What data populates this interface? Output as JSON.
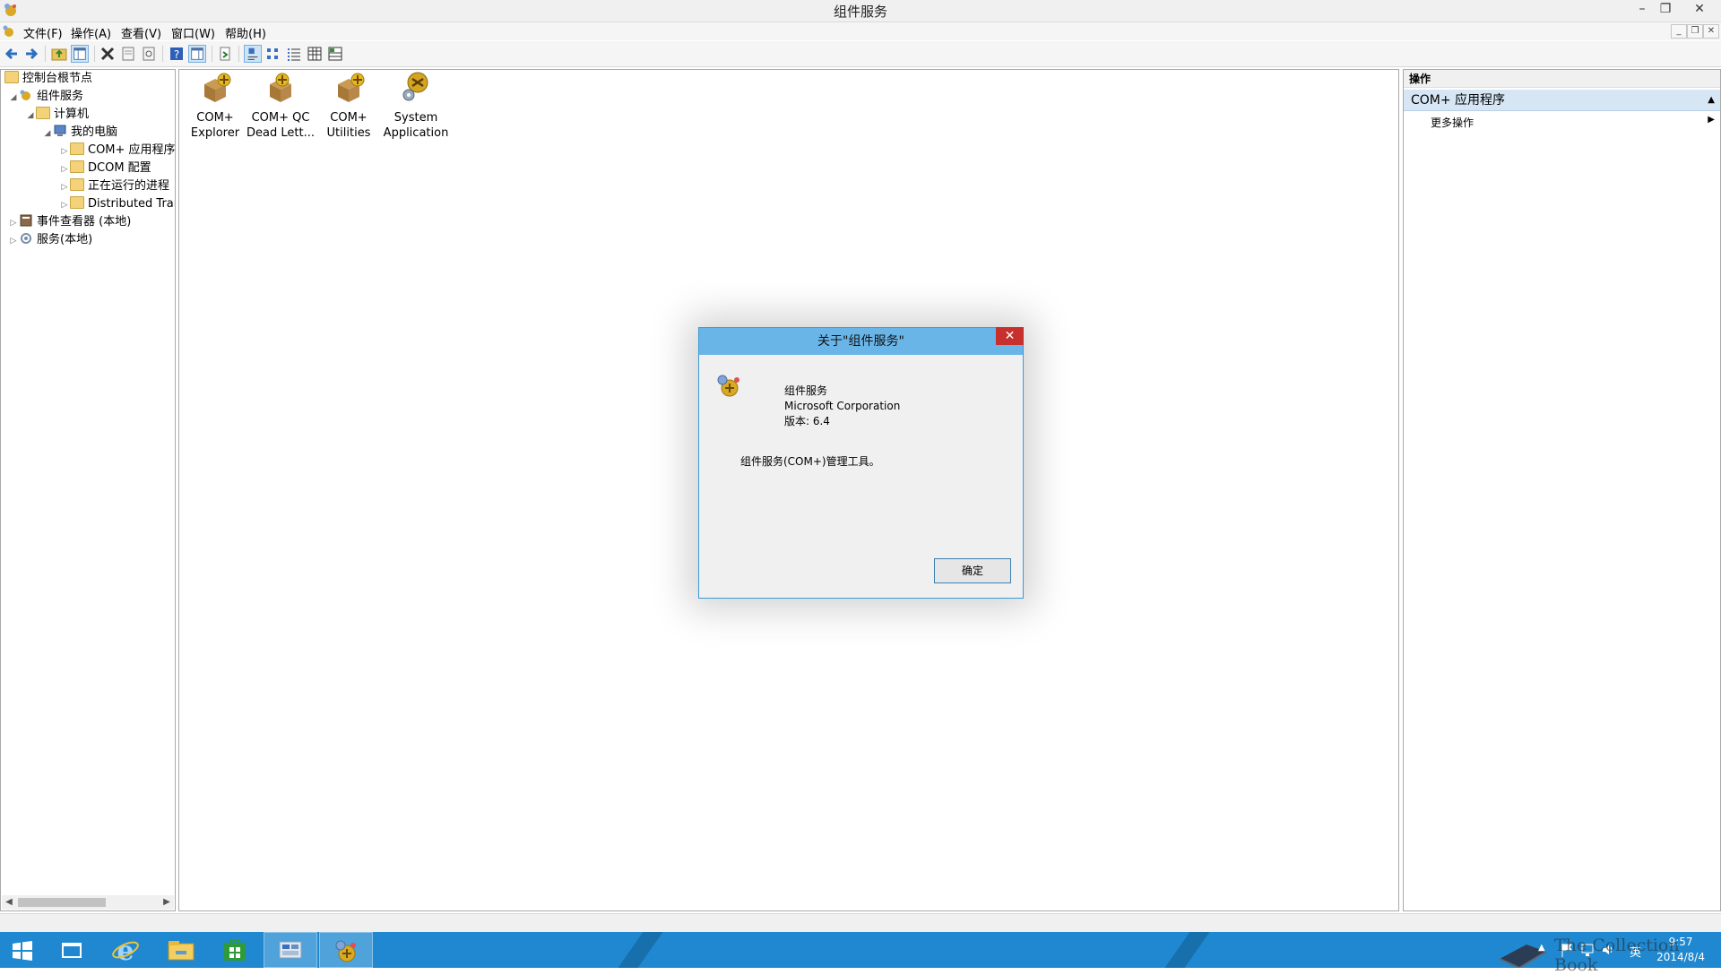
{
  "window": {
    "title": "组件服务",
    "minimize": "–",
    "restore": "❐",
    "close": "✕"
  },
  "menu": {
    "items": [
      "文件(F)",
      "操作(A)",
      "查看(V)",
      "窗口(W)",
      "帮助(H)"
    ]
  },
  "toolbar": {
    "icons": [
      "back-icon",
      "forward-icon",
      "up-folder-icon",
      "show-hide-tree-icon",
      "delete-icon",
      "properties-icon",
      "refresh-icon",
      "help-icon",
      "show-hide-action-pane-icon",
      "export-list-icon",
      "large-icons-view-icon",
      "small-icons-view-icon",
      "list-view-icon",
      "detail-view-icon",
      "status-view-icon"
    ]
  },
  "tree": {
    "items": [
      {
        "label": "控制台根节点",
        "level": 0,
        "expanded": true,
        "icon": "folder"
      },
      {
        "label": "组件服务",
        "level": 1,
        "expanded": true,
        "icon": "component-services"
      },
      {
        "label": "计算机",
        "level": 2,
        "expanded": true,
        "icon": "folder"
      },
      {
        "label": "我的电脑",
        "level": 3,
        "expanded": true,
        "icon": "computer"
      },
      {
        "label": "COM+ 应用程序",
        "level": 4,
        "expanded": false,
        "icon": "folder"
      },
      {
        "label": "DCOM 配置",
        "level": 4,
        "expanded": false,
        "icon": "folder"
      },
      {
        "label": "正在运行的进程",
        "level": 4,
        "expanded": false,
        "icon": "folder"
      },
      {
        "label": "Distributed Trar",
        "level": 4,
        "expanded": false,
        "icon": "folder"
      },
      {
        "label": "事件查看器 (本地)",
        "level": 1,
        "expanded": false,
        "icon": "event-viewer"
      },
      {
        "label": "服务(本地)",
        "level": 1,
        "expanded": false,
        "icon": "services"
      }
    ]
  },
  "content": {
    "icons": [
      {
        "line1": "COM+",
        "line2": "Explorer"
      },
      {
        "line1": "COM+ QC",
        "line2": "Dead Lett..."
      },
      {
        "line1": "COM+",
        "line2": "Utilities"
      },
      {
        "line1": "System",
        "line2": "Application"
      }
    ]
  },
  "actions": {
    "header": "操作",
    "section": "COM+ 应用程序",
    "more": "更多操作"
  },
  "dialog": {
    "title": "关于\"组件服务\"",
    "product": "组件服务",
    "company": "Microsoft Corporation",
    "version": "版本: 6.4",
    "description": "组件服务(COM+)管理工具。",
    "ok": "确定",
    "close": "✕"
  },
  "taskbar": {
    "apps": [
      "start-icon",
      "file-explorer-window-icon",
      "internet-explorer-icon",
      "file-explorer-icon",
      "store-icon",
      "server-manager-icon",
      "component-services-icon"
    ],
    "time": "9:57",
    "date": "2014/8/4",
    "ime": "英"
  },
  "watermark": "The Collection Book",
  "colors": {
    "taskbar": "#1f88d0",
    "dialog_title": "#6ab5e8",
    "close_red": "#c7302c",
    "action_section": "#d6e6f5"
  }
}
